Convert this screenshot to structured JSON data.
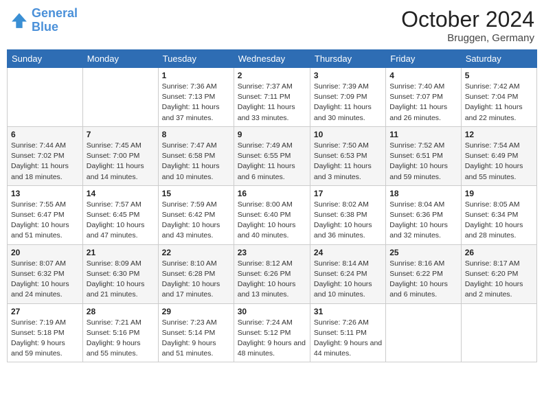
{
  "header": {
    "logo_line1": "General",
    "logo_line2": "Blue",
    "month": "October 2024",
    "location": "Bruggen, Germany"
  },
  "days_of_week": [
    "Sunday",
    "Monday",
    "Tuesday",
    "Wednesday",
    "Thursday",
    "Friday",
    "Saturday"
  ],
  "weeks": [
    [
      {
        "day": "",
        "info": ""
      },
      {
        "day": "",
        "info": ""
      },
      {
        "day": "1",
        "info": "Sunrise: 7:36 AM\nSunset: 7:13 PM\nDaylight: 11 hours and 37 minutes."
      },
      {
        "day": "2",
        "info": "Sunrise: 7:37 AM\nSunset: 7:11 PM\nDaylight: 11 hours and 33 minutes."
      },
      {
        "day": "3",
        "info": "Sunrise: 7:39 AM\nSunset: 7:09 PM\nDaylight: 11 hours and 30 minutes."
      },
      {
        "day": "4",
        "info": "Sunrise: 7:40 AM\nSunset: 7:07 PM\nDaylight: 11 hours and 26 minutes."
      },
      {
        "day": "5",
        "info": "Sunrise: 7:42 AM\nSunset: 7:04 PM\nDaylight: 11 hours and 22 minutes."
      }
    ],
    [
      {
        "day": "6",
        "info": "Sunrise: 7:44 AM\nSunset: 7:02 PM\nDaylight: 11 hours and 18 minutes."
      },
      {
        "day": "7",
        "info": "Sunrise: 7:45 AM\nSunset: 7:00 PM\nDaylight: 11 hours and 14 minutes."
      },
      {
        "day": "8",
        "info": "Sunrise: 7:47 AM\nSunset: 6:58 PM\nDaylight: 11 hours and 10 minutes."
      },
      {
        "day": "9",
        "info": "Sunrise: 7:49 AM\nSunset: 6:55 PM\nDaylight: 11 hours and 6 minutes."
      },
      {
        "day": "10",
        "info": "Sunrise: 7:50 AM\nSunset: 6:53 PM\nDaylight: 11 hours and 3 minutes."
      },
      {
        "day": "11",
        "info": "Sunrise: 7:52 AM\nSunset: 6:51 PM\nDaylight: 10 hours and 59 minutes."
      },
      {
        "day": "12",
        "info": "Sunrise: 7:54 AM\nSunset: 6:49 PM\nDaylight: 10 hours and 55 minutes."
      }
    ],
    [
      {
        "day": "13",
        "info": "Sunrise: 7:55 AM\nSunset: 6:47 PM\nDaylight: 10 hours and 51 minutes."
      },
      {
        "day": "14",
        "info": "Sunrise: 7:57 AM\nSunset: 6:45 PM\nDaylight: 10 hours and 47 minutes."
      },
      {
        "day": "15",
        "info": "Sunrise: 7:59 AM\nSunset: 6:42 PM\nDaylight: 10 hours and 43 minutes."
      },
      {
        "day": "16",
        "info": "Sunrise: 8:00 AM\nSunset: 6:40 PM\nDaylight: 10 hours and 40 minutes."
      },
      {
        "day": "17",
        "info": "Sunrise: 8:02 AM\nSunset: 6:38 PM\nDaylight: 10 hours and 36 minutes."
      },
      {
        "day": "18",
        "info": "Sunrise: 8:04 AM\nSunset: 6:36 PM\nDaylight: 10 hours and 32 minutes."
      },
      {
        "day": "19",
        "info": "Sunrise: 8:05 AM\nSunset: 6:34 PM\nDaylight: 10 hours and 28 minutes."
      }
    ],
    [
      {
        "day": "20",
        "info": "Sunrise: 8:07 AM\nSunset: 6:32 PM\nDaylight: 10 hours and 24 minutes."
      },
      {
        "day": "21",
        "info": "Sunrise: 8:09 AM\nSunset: 6:30 PM\nDaylight: 10 hours and 21 minutes."
      },
      {
        "day": "22",
        "info": "Sunrise: 8:10 AM\nSunset: 6:28 PM\nDaylight: 10 hours and 17 minutes."
      },
      {
        "day": "23",
        "info": "Sunrise: 8:12 AM\nSunset: 6:26 PM\nDaylight: 10 hours and 13 minutes."
      },
      {
        "day": "24",
        "info": "Sunrise: 8:14 AM\nSunset: 6:24 PM\nDaylight: 10 hours and 10 minutes."
      },
      {
        "day": "25",
        "info": "Sunrise: 8:16 AM\nSunset: 6:22 PM\nDaylight: 10 hours and 6 minutes."
      },
      {
        "day": "26",
        "info": "Sunrise: 8:17 AM\nSunset: 6:20 PM\nDaylight: 10 hours and 2 minutes."
      }
    ],
    [
      {
        "day": "27",
        "info": "Sunrise: 7:19 AM\nSunset: 5:18 PM\nDaylight: 9 hours and 59 minutes."
      },
      {
        "day": "28",
        "info": "Sunrise: 7:21 AM\nSunset: 5:16 PM\nDaylight: 9 hours and 55 minutes."
      },
      {
        "day": "29",
        "info": "Sunrise: 7:23 AM\nSunset: 5:14 PM\nDaylight: 9 hours and 51 minutes."
      },
      {
        "day": "30",
        "info": "Sunrise: 7:24 AM\nSunset: 5:12 PM\nDaylight: 9 hours and 48 minutes."
      },
      {
        "day": "31",
        "info": "Sunrise: 7:26 AM\nSunset: 5:11 PM\nDaylight: 9 hours and 44 minutes."
      },
      {
        "day": "",
        "info": ""
      },
      {
        "day": "",
        "info": ""
      }
    ]
  ]
}
